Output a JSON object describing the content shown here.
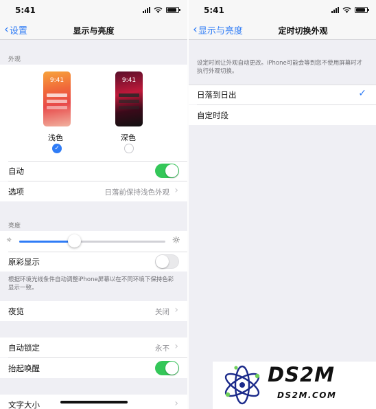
{
  "left": {
    "status": {
      "time": "5:41"
    },
    "nav": {
      "back": "设置",
      "title": "显示与亮度"
    },
    "appearance": {
      "section": "外观",
      "light": {
        "label": "浅色",
        "time": "9:41",
        "selected": true
      },
      "dark": {
        "label": "深色",
        "time": "9:41",
        "selected": false
      }
    },
    "auto": {
      "label": "自动",
      "on": true
    },
    "options": {
      "label": "选项",
      "value": "日落前保持浅色外观"
    },
    "brightness": {
      "section": "亮度",
      "level": 0.38
    },
    "true_tone": {
      "label": "原彩显示",
      "on": false,
      "footnote": "根据环境光线条件自动调整iPhone屏幕以在不同环境下保持色彩显示一致。"
    },
    "night_shift": {
      "label": "夜览",
      "value": "关闭"
    },
    "auto_lock": {
      "label": "自动锁定",
      "value": "永不"
    },
    "raise_to_wake": {
      "label": "抬起唤醒",
      "on": true
    },
    "text_size": {
      "label": "文字大小"
    }
  },
  "right": {
    "status": {
      "time": "5:41"
    },
    "nav": {
      "back": "显示与亮度",
      "title": "定时切换外观"
    },
    "description": "设定时间让外观自动更改。iPhone可能会等到您不使用屏幕时才执行外观切换。",
    "options": [
      {
        "label": "日落到日出",
        "checked": true
      },
      {
        "label": "自定时段",
        "checked": false
      }
    ]
  },
  "watermark": {
    "title": "DS2M",
    "url": "DS2M.COM"
  },
  "colors": {
    "accent": "#2f7cf6",
    "switch_on": "#34c759",
    "background": "#efeff4"
  },
  "icons": [
    "chevron-left-icon",
    "chevron-right-icon",
    "checkmark-icon",
    "sun-icon",
    "wifi-icon",
    "battery-icon",
    "signal-icon"
  ]
}
